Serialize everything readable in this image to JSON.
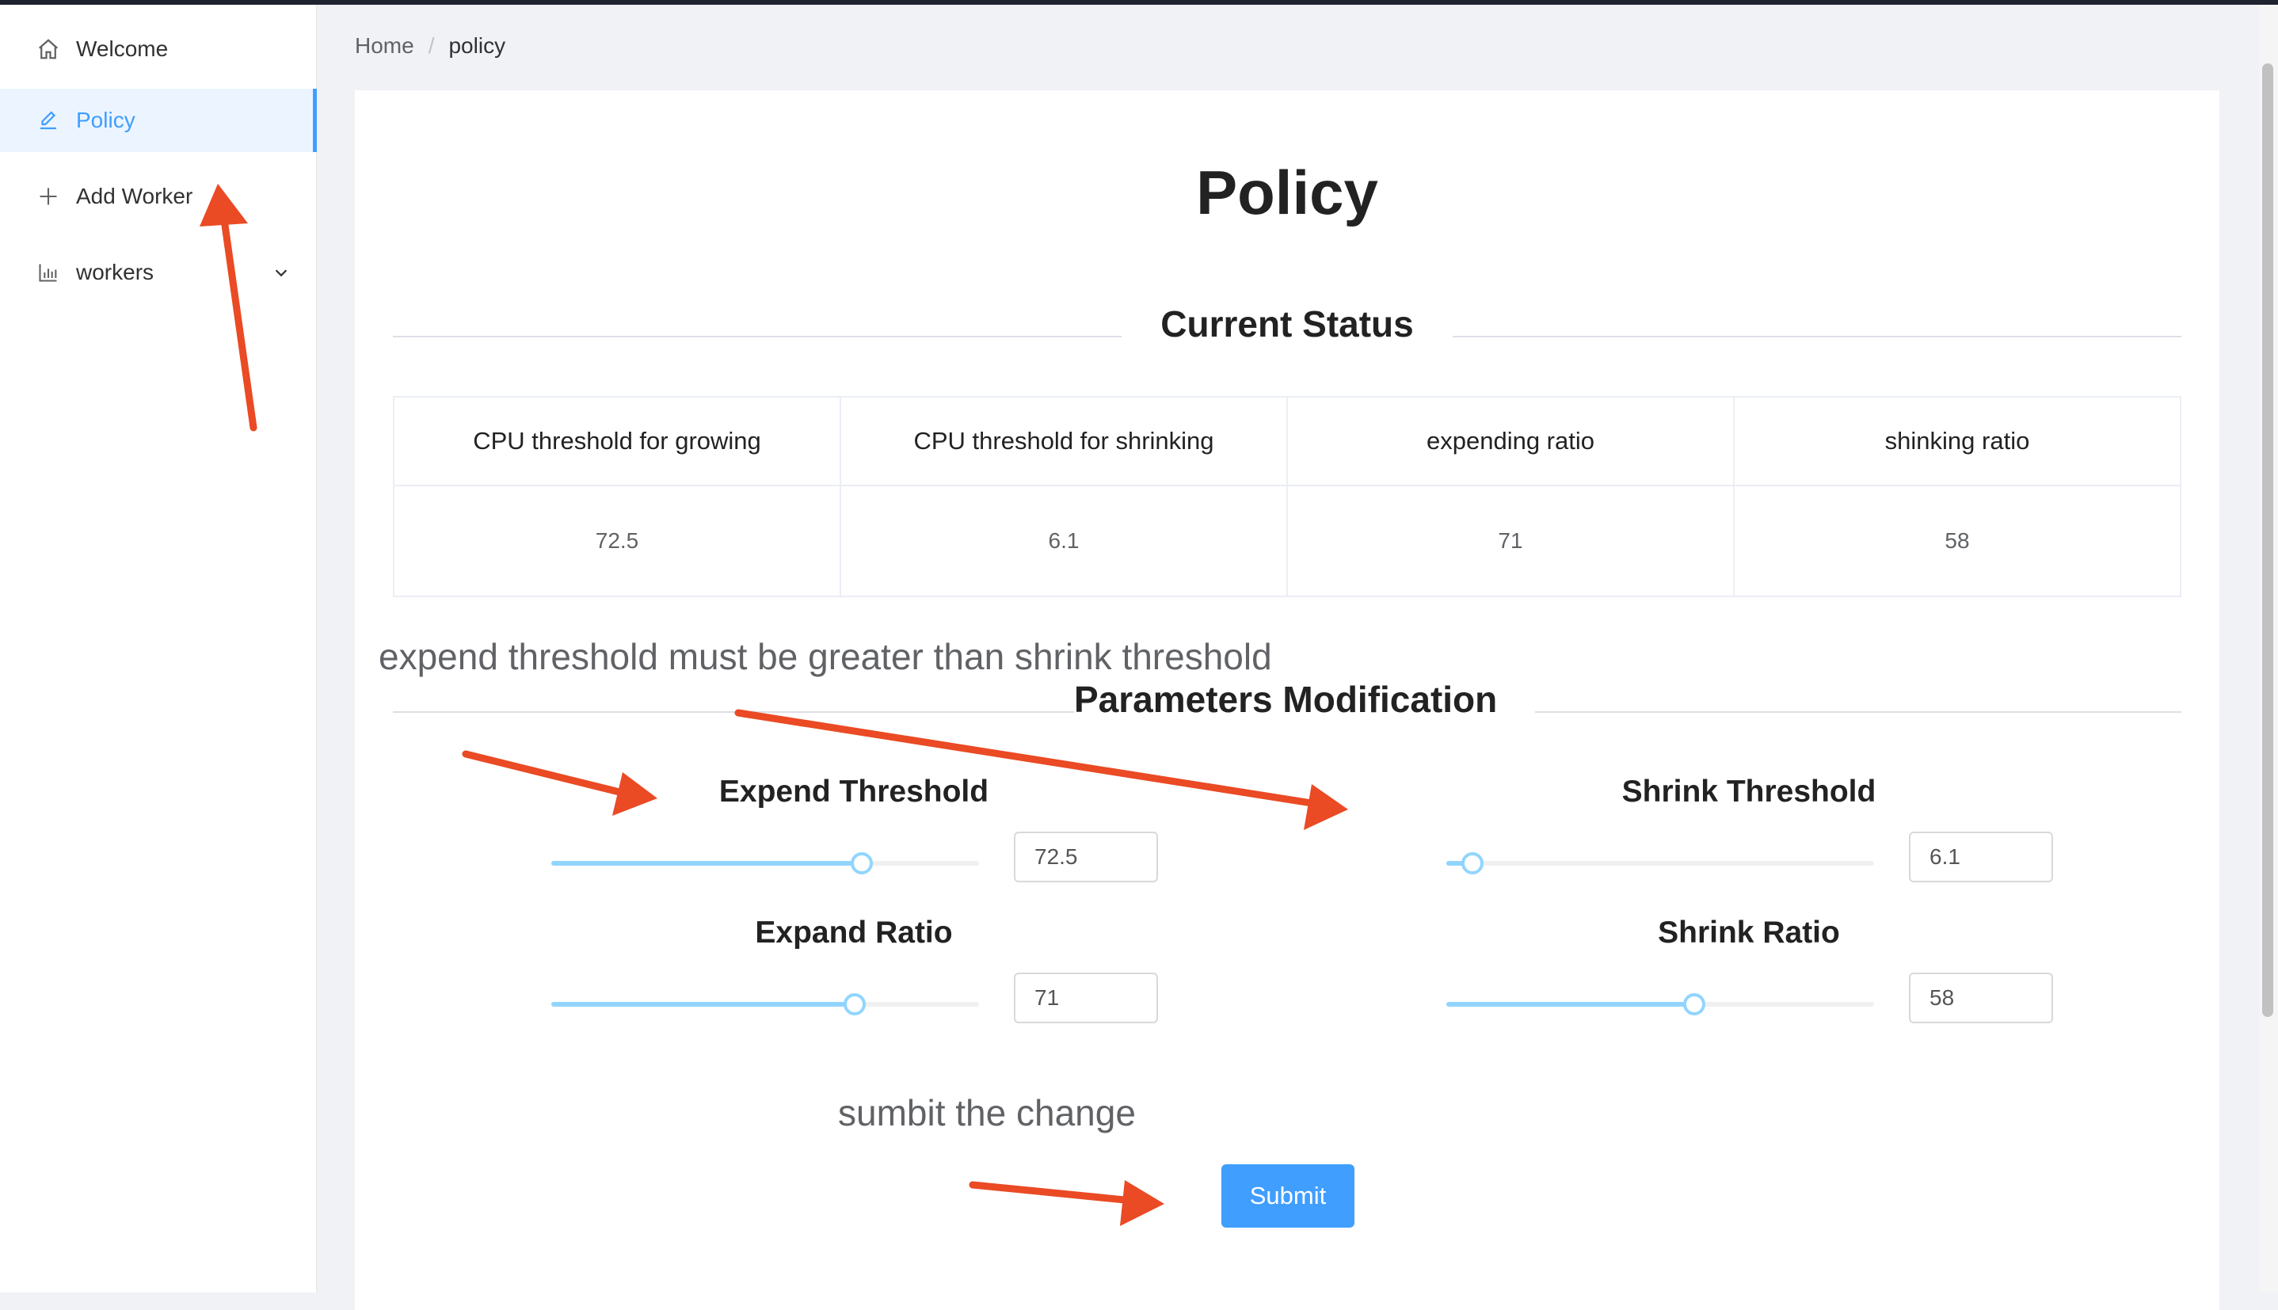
{
  "sidebar": {
    "items": [
      {
        "label": "Welcome",
        "icon": "home-icon"
      },
      {
        "label": "Policy",
        "icon": "edit-icon",
        "active": true
      },
      {
        "label": "Add Worker",
        "icon": "plus-icon"
      },
      {
        "label": "workers",
        "icon": "bar-chart-icon",
        "expandable": true
      }
    ]
  },
  "breadcrumb": {
    "home": "Home",
    "separator": "/",
    "current": "policy"
  },
  "main": {
    "title": "Policy",
    "current_status": {
      "title": "Current Status",
      "columns": [
        "CPU threshold for growing",
        "CPU threshold for shrinking",
        "expending ratio",
        "shinking ratio"
      ],
      "values": [
        "72.5",
        "6.1",
        "71",
        "58"
      ]
    },
    "warning": "expend threshold must be greater than shrink threshold",
    "params": {
      "title": "Parameters Modification",
      "expend_threshold": {
        "label": "Expend Threshold",
        "value": "72.5",
        "slider_fraction": 0.725
      },
      "shrink_threshold": {
        "label": "Shrink Threshold",
        "value": "6.1",
        "slider_fraction": 0.061
      },
      "expand_ratio": {
        "label": "Expand Ratio",
        "value": "71",
        "slider_fraction": 0.71
      },
      "shrink_ratio": {
        "label": "Shrink Ratio",
        "value": "58",
        "slider_fraction": 0.58
      }
    },
    "submit_hint": "sumbit the change",
    "submit_label": "Submit"
  },
  "colors": {
    "accent": "#409eff",
    "slider": "#91d5ff",
    "annotation_arrow": "#ea4a24"
  }
}
